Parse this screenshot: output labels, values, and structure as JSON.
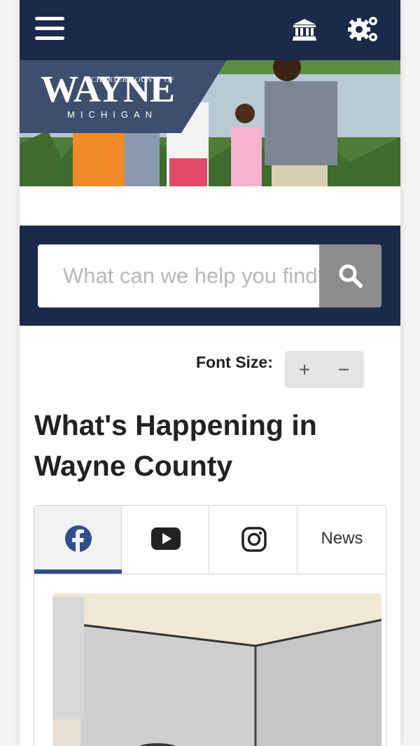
{
  "header": {
    "menu_icon": "hamburger-menu-icon",
    "government_icon": "government-building-icon",
    "settings_icon": "gears-icon",
    "colors": {
      "navy": "#1b2a4a",
      "accent": "#2e4f8a"
    }
  },
  "banner": {
    "logo_top": "CHARTER COUNTY OF",
    "logo_main": "WAYNE",
    "logo_sub": "MICHIGAN"
  },
  "search": {
    "placeholder": "What can we help you find?",
    "button_icon": "search-icon"
  },
  "font_size": {
    "label": "Font Size:",
    "increase": "+",
    "decrease": "−"
  },
  "main": {
    "heading": "What's Happening in Wayne County",
    "tabs": [
      {
        "icon": "facebook-icon",
        "label": "",
        "active": true
      },
      {
        "icon": "youtube-icon",
        "label": "",
        "active": false
      },
      {
        "icon": "instagram-icon",
        "label": "",
        "active": false
      },
      {
        "icon": "",
        "label": "News",
        "active": false
      }
    ]
  }
}
